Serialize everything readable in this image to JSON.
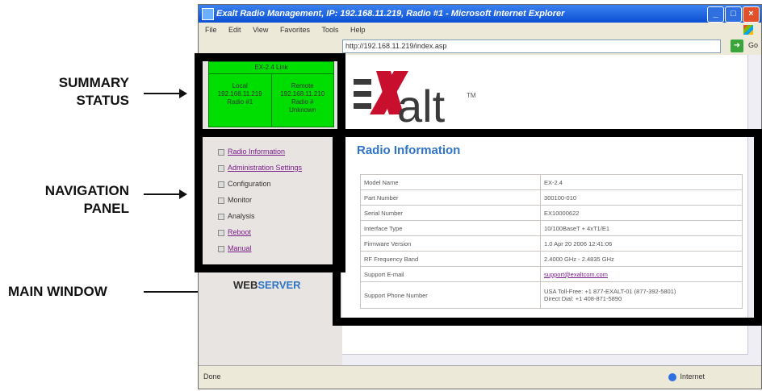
{
  "annotations": {
    "summary_status": [
      "SUMMARY",
      "STATUS"
    ],
    "navigation_panel": [
      "NAVIGATION",
      "PANEL"
    ],
    "main_window": "MAIN WINDOW"
  },
  "browser": {
    "title": "Exalt Radio Management, IP: 192.168.11.219, Radio #1 - Microsoft Internet Explorer",
    "menu": [
      "File",
      "Edit",
      "View",
      "Favorites",
      "Tools",
      "Help"
    ],
    "address": "http://192.168.11.219/index.asp",
    "go_label": "Go",
    "status_left": "Done",
    "status_right": "Internet"
  },
  "summary": {
    "header": "EX-2.4 Link",
    "local": [
      "Local",
      "192.168.11.219",
      "Radio #1"
    ],
    "remote": [
      "Remote",
      "192.168.11.210",
      "Radio #",
      "Unknown"
    ]
  },
  "nav": {
    "items": [
      {
        "label": "Radio Information",
        "link": true
      },
      {
        "label": "Administration Settings",
        "link": true
      },
      {
        "label": "Configuration",
        "link": false
      },
      {
        "label": "Monitor",
        "link": false
      },
      {
        "label": "Analysis",
        "link": false
      },
      {
        "label": "Reboot",
        "link": true
      },
      {
        "label": "Manual",
        "link": true
      }
    ],
    "webserver": {
      "part1": "WEB",
      "part2": "SERVER"
    }
  },
  "logo": {
    "word": "alt",
    "tm": "TM"
  },
  "main": {
    "title": "Radio Information",
    "rows": [
      {
        "key": "Model Name",
        "value": "EX-2.4"
      },
      {
        "key": "Part Number",
        "value": "300100-010"
      },
      {
        "key": "Serial Number",
        "value": "EX10000622"
      },
      {
        "key": "Interface Type",
        "value": "10/100BaseT + 4xT1/E1"
      },
      {
        "key": "Firmware Version",
        "value": "1.0 Apr 20 2006 12:41:06"
      },
      {
        "key": "RF Frequency Band",
        "value": "2.4000 GHz - 2.4835 GHz"
      },
      {
        "key": "Support E-mail",
        "value": "support@exaltcom.com"
      },
      {
        "key": "Support Phone Number",
        "value": "USA Toll-Free: +1 877-EXALT-01 (877-392-5801)",
        "value2": "Direct Dial: +1 408-871-5890"
      }
    ]
  }
}
